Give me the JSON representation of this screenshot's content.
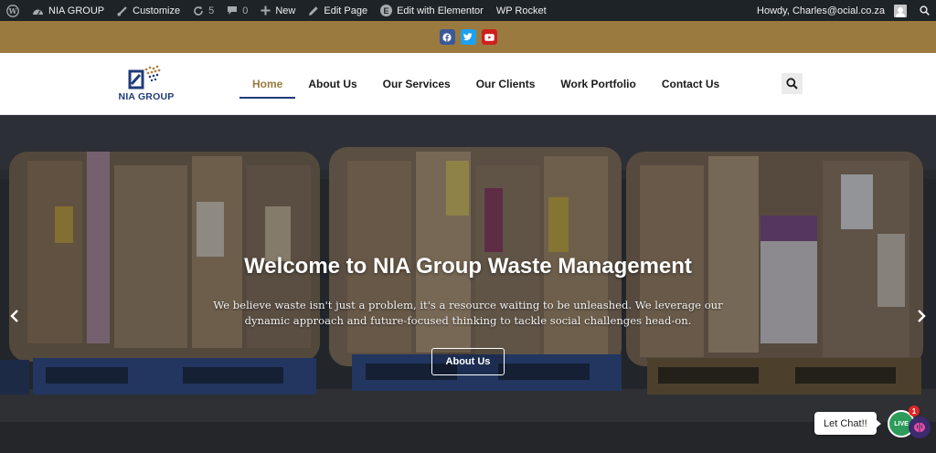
{
  "admin_bar": {
    "site_name": "NIA GROUP",
    "customize": "Customize",
    "updates_count": "5",
    "comments_count": "0",
    "new_label": "New",
    "edit_page": "Edit Page",
    "edit_elementor": "Edit with Elementor",
    "wp_rocket": "WP Rocket",
    "howdy": "Howdy, Charles@ocial.co.za"
  },
  "social": [
    "facebook-icon",
    "twitter-icon",
    "youtube-icon"
  ],
  "header": {
    "logo_text": "NIA GROUP",
    "nav": [
      {
        "label": "Home",
        "active": true
      },
      {
        "label": "About Us"
      },
      {
        "label": "Our Services"
      },
      {
        "label": "Our Clients"
      },
      {
        "label": "Work Portfolio"
      },
      {
        "label": "Contact Us"
      }
    ]
  },
  "hero": {
    "title": "Welcome to NIA Group Waste Management",
    "subtitle": "We believe waste isn't just a problem, it's a resource waiting to be unleashed. We leverage our dynamic approach and future-focused thinking to tackle social challenges head-on.",
    "button": "About Us"
  },
  "chat": {
    "label": "Let Chat!!",
    "badge": "1",
    "live": "LIVE"
  },
  "colors": {
    "accent_gold": "#9b7a40",
    "brand_blue": "#1f3b78",
    "admin_bar": "#1d2327"
  }
}
